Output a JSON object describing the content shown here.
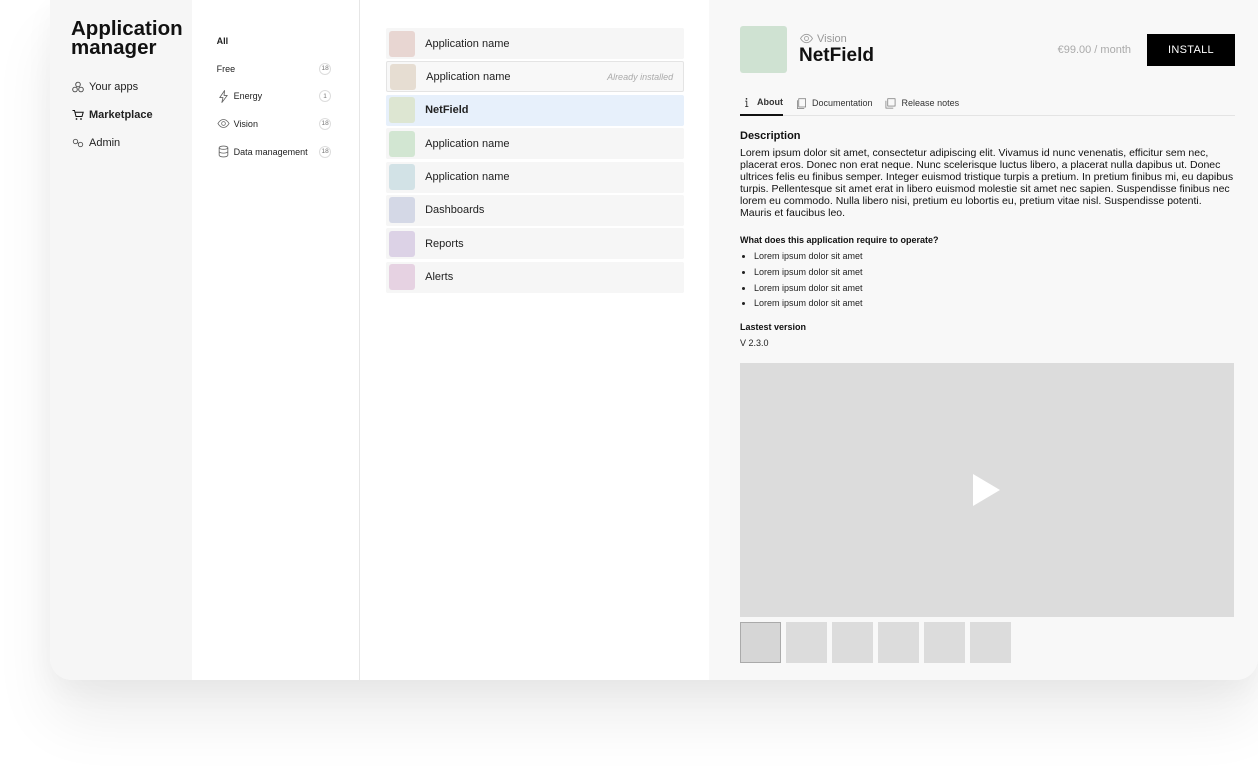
{
  "app": {
    "title_line1": "Application",
    "title_line2": "manager"
  },
  "nav": [
    {
      "label": "Your apps",
      "icon": "apps-icon"
    },
    {
      "label": "Marketplace",
      "icon": "cart-icon",
      "active": true
    },
    {
      "label": "Admin",
      "icon": "admin-icon"
    }
  ],
  "categories": [
    {
      "label": "All",
      "count": ""
    },
    {
      "label": "Free",
      "count": "18"
    },
    {
      "label": "Energy",
      "count": "1"
    },
    {
      "label": "Vision",
      "count": "18"
    },
    {
      "label": "Data management",
      "count": "18"
    }
  ],
  "apps": [
    {
      "name": "Application name",
      "note": "",
      "color": "#e8d6d2"
    },
    {
      "name": "Application name",
      "note": "Already installed",
      "color": "#e6ddd2"
    },
    {
      "name": "NetField",
      "note": "",
      "color": "#dde6d2"
    },
    {
      "name": "Application name",
      "note": "",
      "color": "#d2e6d2"
    },
    {
      "name": "Application name",
      "note": "",
      "color": "#d2e2e6"
    },
    {
      "name": "Dashboards",
      "note": "",
      "color": "#d4d8e6"
    },
    {
      "name": "Reports",
      "note": "",
      "color": "#dcd2e6"
    },
    {
      "name": "Alerts",
      "note": "",
      "color": "#e6d2e2"
    }
  ],
  "detail": {
    "category": "Vision",
    "name": "NetField",
    "price": "€99.00 / month",
    "install_label": "INSTALL",
    "hero_color": "#cfe2d2",
    "tabs": [
      "About",
      "Documentation",
      "Release notes"
    ],
    "description_heading": "Description",
    "description": "Lorem ipsum dolor sit amet, consectetur adipiscing elit. Vivamus id nunc venenatis, efficitur sem nec, placerat eros. Donec non erat neque. Nunc scelerisque luctus libero, a placerat nulla dapibus ut. Donec ultrices felis eu finibus semper. Integer euismod tristique turpis a pretium. In pretium finibus mi, eu dapibus turpis. Pellentesque sit amet erat in libero euismod molestie sit amet nec sapien. Suspendisse finibus nec lorem eu commodo. Nulla libero nisi, pretium eu lobortis eu, pretium vitae nisl. Suspendisse potenti. Mauris et faucibus leo.",
    "requirements_heading": "What does this application require to operate?",
    "requirements": [
      "Lorem ipsum dolor sit amet",
      "Lorem ipsum dolor sit amet",
      "Lorem ipsum dolor sit amet",
      "Lorem ipsum dolor sit amet"
    ],
    "version_heading": "Lastest version",
    "version": "V 2.3.0"
  },
  "colors": {
    "selected_row": "#e7f0fb",
    "install_bg": "#000000"
  }
}
